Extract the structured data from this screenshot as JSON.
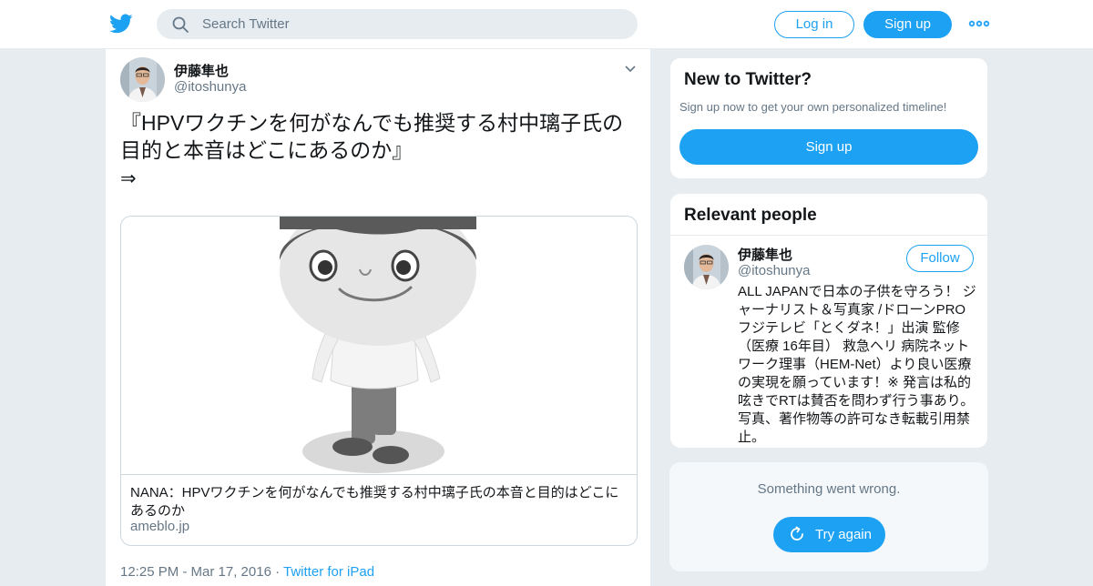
{
  "nav": {
    "logo_icon": "twitter-bird-icon",
    "search_placeholder": "Search Twitter",
    "login_label": "Log in",
    "signup_label": "Sign up",
    "more_icon": "more-dots-icon",
    "accent": "#1da1f2"
  },
  "tweet": {
    "author_name": "伊藤隼也",
    "author_handle": "@itoshunya",
    "text": "『HPVワクチンを何がなんでも推奨する村中璃子氏の目的と本音はどこにあるのか』",
    "arrow": "⇒",
    "card": {
      "title": "NANA：HPVワクチンを何がなんでも推奨する村中璃子氏の本音と目的はどこにあるのか",
      "domain": "ameblo.jp"
    },
    "timestamp": "12:25 PM - Mar 17, 2016",
    "separator": "·",
    "source": "Twitter for iPad"
  },
  "sidebar": {
    "new_to_twitter": {
      "title": "New to Twitter?",
      "subtitle": "Sign up now to get your own personalized timeline!",
      "button": "Sign up"
    },
    "relevant_people": {
      "title": "Relevant people",
      "name": "伊藤隼也",
      "handle": "@itoshunya",
      "follow_label": "Follow",
      "bio": "ALL JAPANで日本の子供を守ろう！ ジャーナリスト＆写真家 /ドローンPRO フジテレビ「とくダネ！」出演 監修（医療 16年目） 救急ヘリ 病院ネットワーク理事（HEM-Net）より良い医療の実現を願っています！※ 発言は私的呟きでRTは賛否を問わず行う事あり。写真、著作物等の許可なき転載引用禁止。"
    },
    "error": {
      "message": "Something went wrong.",
      "retry_label": "Try again"
    }
  }
}
